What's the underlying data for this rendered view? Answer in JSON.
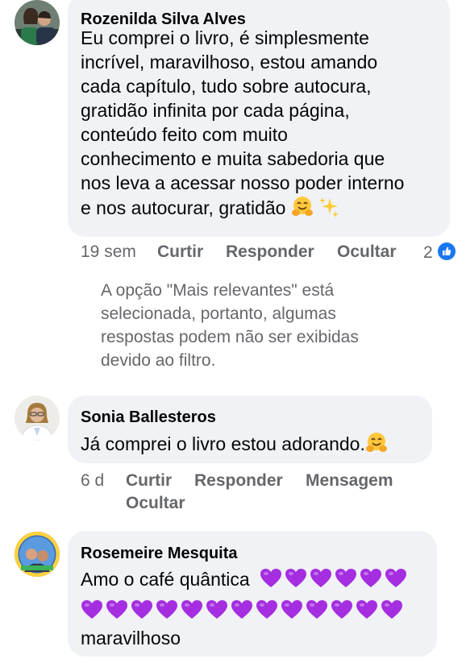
{
  "comments": [
    {
      "author": "Rozenilda Silva Alves",
      "lines": [
        "Eu comprei o livro, é simplesmente",
        "incrível, maravilhoso, estou amando",
        "cada capítulo, tudo sobre autocura,",
        "gratidão infinita por cada página,",
        "conteúdo feito com muito",
        "conhecimento e muita sabedoria que",
        "nos leva a acessar nosso poder interno",
        "e nos autocurar, gratidão"
      ],
      "emojis": [
        "hugging-face-emoji",
        "sparkles-emoji"
      ],
      "time": "19 sem",
      "actions": [
        "Curtir",
        "Responder",
        "Ocultar"
      ],
      "reaction_count": "2",
      "reaction_icon": "like-icon"
    },
    {
      "author": "Sonia Ballesteros",
      "text": "Já comprei o livro estou adorando.",
      "emojis": [
        "hugging-face-emoji"
      ],
      "time": "6 d",
      "actions": [
        "Curtir",
        "Responder",
        "Mensagem",
        "Ocultar"
      ]
    },
    {
      "author": "Rosemeire Mesquita",
      "line1": "Amo o café quântica",
      "line3": "maravilhoso",
      "purple_hearts_line1": 6,
      "purple_hearts_line2": 13
    }
  ],
  "filter_notice": [
    "A opção \"Mais relevantes\" está",
    "selecionada, portanto, algumas",
    "respostas podem não ser exibidas",
    "devido ao filtro."
  ],
  "colors": {
    "bubble": "#f0f2f5",
    "meta_text": "#65676b",
    "like_blue": "#1877f2",
    "purple_heart": "#a52ee0"
  }
}
